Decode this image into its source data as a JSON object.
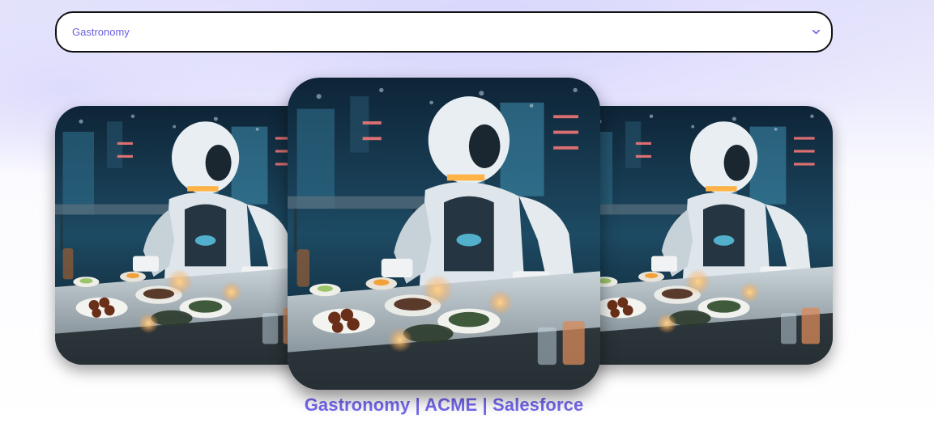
{
  "dropdown": {
    "selected": "Gastronomy",
    "icon": "chevron-down-icon"
  },
  "carousel": {
    "items": [
      {
        "position": "previous",
        "image": "robot-chef-restaurant-image"
      },
      {
        "position": "current",
        "image": "robot-chef-restaurant-image"
      },
      {
        "position": "next",
        "image": "robot-chef-restaurant-image"
      }
    ],
    "caption": "Gastronomy | ACME | Salesforce"
  },
  "colors": {
    "accent": "#7468ee",
    "dropdown_text": "#6a5ee0",
    "border": "#111111"
  }
}
